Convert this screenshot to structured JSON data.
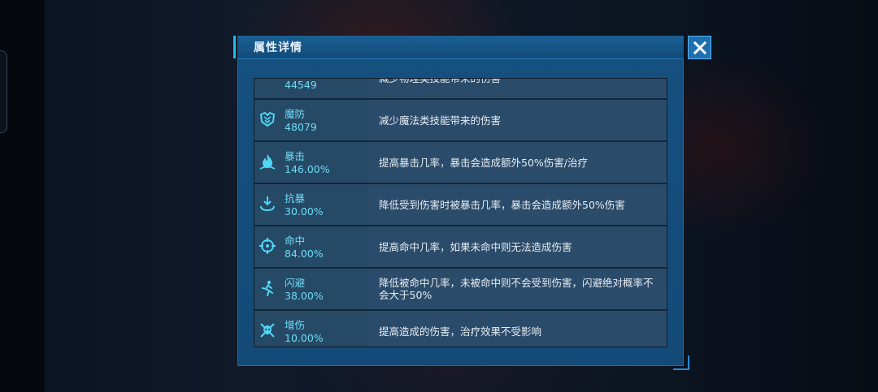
{
  "dialog": {
    "title": "属性详情"
  },
  "attributes": [
    {
      "name": "",
      "value": "44549",
      "icon": "physical-defense-icon",
      "desc": "减少物理类技能带来的伤害"
    },
    {
      "name": "魔防",
      "value": "48079",
      "icon": "magic-defense-icon",
      "desc": "减少魔法类技能带来的伤害"
    },
    {
      "name": "暴击",
      "value": "146.00%",
      "icon": "flame-crit-icon",
      "desc": "提高暴击几率，暴击会造成额外50%伤害/治疗"
    },
    {
      "name": "抗暴",
      "value": "30.00%",
      "icon": "anti-crit-icon",
      "desc": "降低受到伤害时被暴击几率，暴击会造成额外50%伤害"
    },
    {
      "name": "命中",
      "value": "84.00%",
      "icon": "crosshair-icon",
      "desc": "提高命中几率，如果未命中则无法造成伤害"
    },
    {
      "name": "闪避",
      "value": "38.00%",
      "icon": "running-dodge-icon",
      "desc": "降低被命中几率，未被命中则不会受到伤害，闪避绝对概率不会大于50%"
    },
    {
      "name": "增伤",
      "value": "10.00%",
      "icon": "skull-damage-icon",
      "desc": "提高造成的伤害，治疗效果不受影响"
    }
  ],
  "colors": {
    "accent": "#27b8ee",
    "stat_text": "#6fdcf5",
    "panel": "#15507f"
  }
}
